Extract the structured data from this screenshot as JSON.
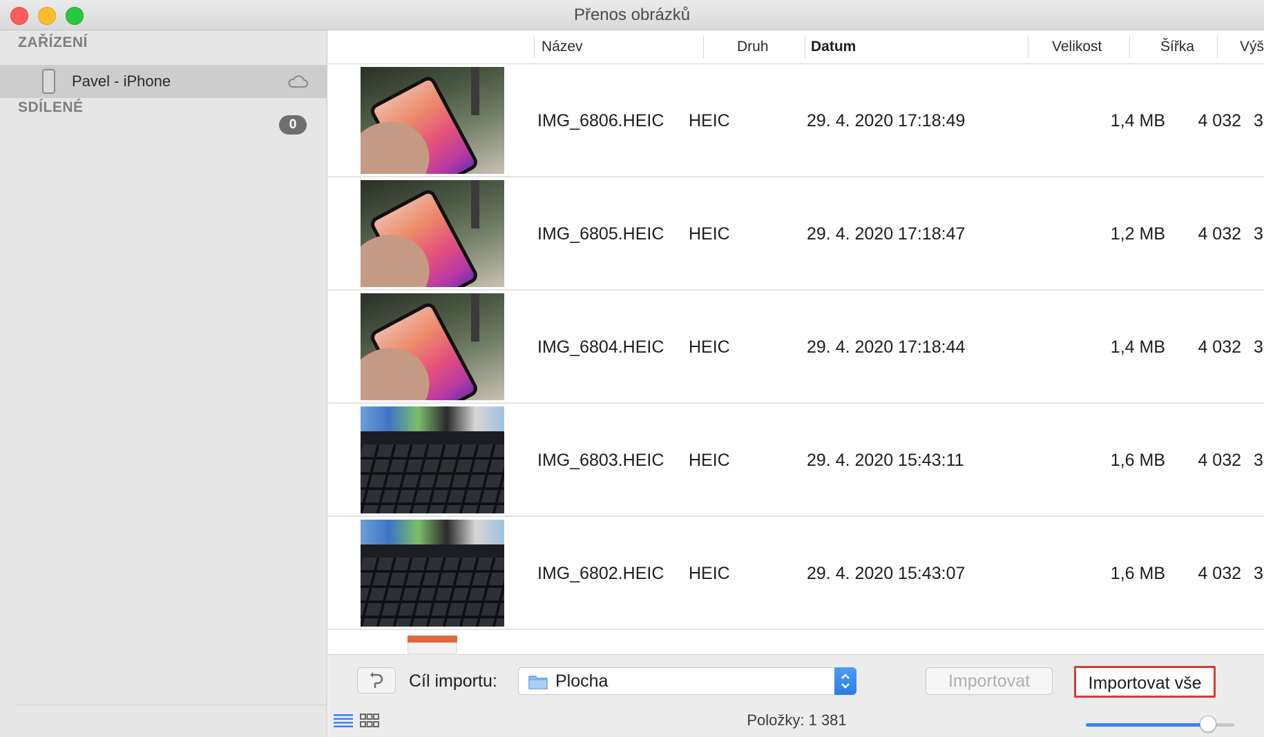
{
  "window": {
    "title": "Přenos obrázků"
  },
  "sidebar": {
    "devices_heading": "ZAŘÍZENÍ",
    "device": {
      "name": "Pavel - iPhone",
      "icon": "iphone-icon",
      "status_icon": "cloud-icon"
    },
    "shared_heading": "SDÍLENÉ",
    "shared_count": "0",
    "bottom_icon": "image-preview-icon"
  },
  "table": {
    "columns": {
      "name": "Název",
      "kind": "Druh",
      "date": "Datum",
      "size": "Velikost",
      "width": "Šířka",
      "height": "Výš"
    },
    "sort_column": "Datum",
    "sort_indicator_icon": "chevron-down-icon",
    "rows": [
      {
        "name": "IMG_6806.HEIC",
        "kind": "HEIC",
        "date": "29. 4. 2020 17:18:49",
        "size": "1,4 MB",
        "width": "4 032",
        "height": "3",
        "thumbnail": "phone-in-hand"
      },
      {
        "name": "IMG_6805.HEIC",
        "kind": "HEIC",
        "date": "29. 4. 2020 17:18:47",
        "size": "1,2 MB",
        "width": "4 032",
        "height": "3",
        "thumbnail": "phone-in-hand"
      },
      {
        "name": "IMG_6804.HEIC",
        "kind": "HEIC",
        "date": "29. 4. 2020 17:18:44",
        "size": "1,4 MB",
        "width": "4 032",
        "height": "3",
        "thumbnail": "phone-in-hand"
      },
      {
        "name": "IMG_6803.HEIC",
        "kind": "HEIC",
        "date": "29. 4. 2020 15:43:11",
        "size": "1,6 MB",
        "width": "4 032",
        "height": "3",
        "thumbnail": "macbook-keyboard"
      },
      {
        "name": "IMG_6802.HEIC",
        "kind": "HEIC",
        "date": "29. 4. 2020 15:43:07",
        "size": "1,6 MB",
        "width": "4 032",
        "height": "3",
        "thumbnail": "macbook-keyboard"
      }
    ]
  },
  "bottombar": {
    "rotate_icon": "rotate-icon",
    "destination_label": "Cíl importu:",
    "destination_value": "Plocha",
    "destination_icon": "folder-icon",
    "import_label": "Importovat",
    "import_all_label": "Importovat vše",
    "status": "Položky: 1 381",
    "thumbnail_size_fraction": 0.77
  },
  "colors": {
    "highlight_border": "#d83b30",
    "accent": "#3a82f0"
  }
}
